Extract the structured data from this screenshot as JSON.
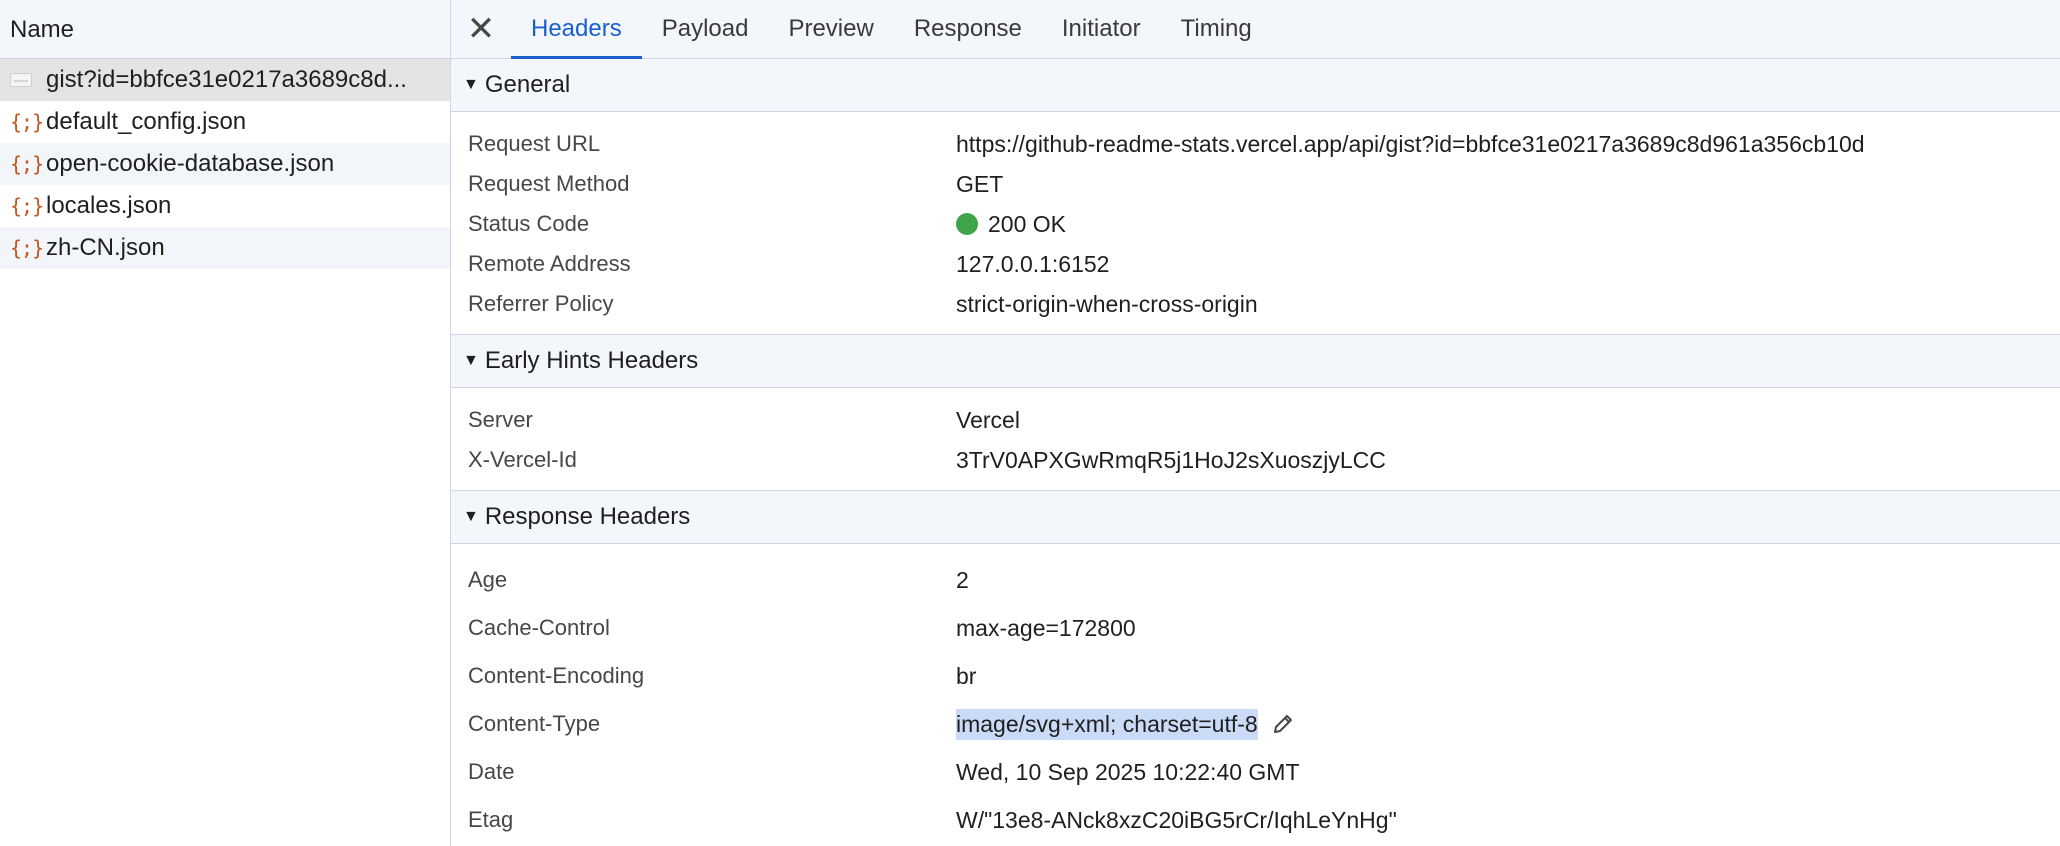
{
  "left_panel": {
    "column_header": "Name",
    "requests": [
      {
        "name": "gist?id=bbfce31e0217a3689c8d...",
        "icon": "image-icon",
        "selected": true
      },
      {
        "name": "default_config.json",
        "icon": "json-icon",
        "icon_glyph": "{;}"
      },
      {
        "name": "open-cookie-database.json",
        "icon": "json-icon",
        "icon_glyph": "{;}"
      },
      {
        "name": "locales.json",
        "icon": "json-icon",
        "icon_glyph": "{;}"
      },
      {
        "name": "zh-CN.json",
        "icon": "json-icon",
        "icon_glyph": "{;}"
      }
    ]
  },
  "tabs": {
    "close_glyph": "✕",
    "items": [
      "Headers",
      "Payload",
      "Preview",
      "Response",
      "Initiator",
      "Timing"
    ],
    "active": "Headers"
  },
  "general": {
    "title": "General",
    "rows": [
      {
        "key": "Request URL",
        "value": "https://github-readme-stats.vercel.app/api/gist?id=bbfce31e0217a3689c8d961a356cb10d"
      },
      {
        "key": "Request Method",
        "value": "GET"
      },
      {
        "key": "Status Code",
        "value": "200 OK",
        "status_color": "#3fa44b"
      },
      {
        "key": "Remote Address",
        "value": "127.0.0.1:6152"
      },
      {
        "key": "Referrer Policy",
        "value": "strict-origin-when-cross-origin"
      }
    ]
  },
  "early_hints": {
    "title": "Early Hints Headers",
    "rows": [
      {
        "key": "Server",
        "value": "Vercel"
      },
      {
        "key": "X-Vercel-Id",
        "value": "3TrV0APXGwRmqR5j1HoJ2sXuoszjyLCC"
      }
    ]
  },
  "response_headers": {
    "title": "Response Headers",
    "rows": [
      {
        "key": "Age",
        "value": "2"
      },
      {
        "key": "Cache-Control",
        "value": "max-age=172800"
      },
      {
        "key": "Content-Encoding",
        "value": "br"
      },
      {
        "key": "Content-Type",
        "value": "image/svg+xml; charset=utf-8",
        "highlighted": true,
        "editable": true
      },
      {
        "key": "Date",
        "value": "Wed, 10 Sep 2025 10:22:40 GMT"
      },
      {
        "key": "Etag",
        "value": "W/\"13e8-ANck8xzC20iBG5rCr/IqhLeYnHg\""
      }
    ]
  },
  "colors": {
    "accent": "#1a5fd0",
    "json_icon": "#c5561a",
    "selection_highlight": "#c9dbf6"
  }
}
